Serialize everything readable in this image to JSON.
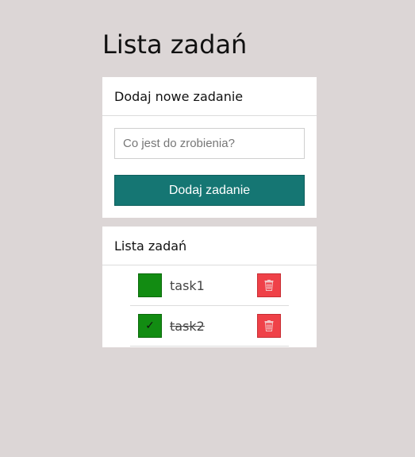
{
  "page": {
    "title": "Lista zadań"
  },
  "add_task": {
    "header": "Dodaj nowe zadanie",
    "input_placeholder": "Co jest do zrobienia?",
    "input_value": "",
    "button_label": "Dodaj zadanie"
  },
  "task_list": {
    "header": "Lista zadań",
    "items": [
      {
        "label": "task1",
        "done": false,
        "check_icon": "",
        "delete_icon": "trash-icon"
      },
      {
        "label": "task2",
        "done": true,
        "check_icon": "✓",
        "delete_icon": "trash-icon"
      }
    ]
  },
  "colors": {
    "background": "#dcd6d6",
    "primary": "#157673",
    "check": "#128c12",
    "delete": "#ef4148"
  }
}
